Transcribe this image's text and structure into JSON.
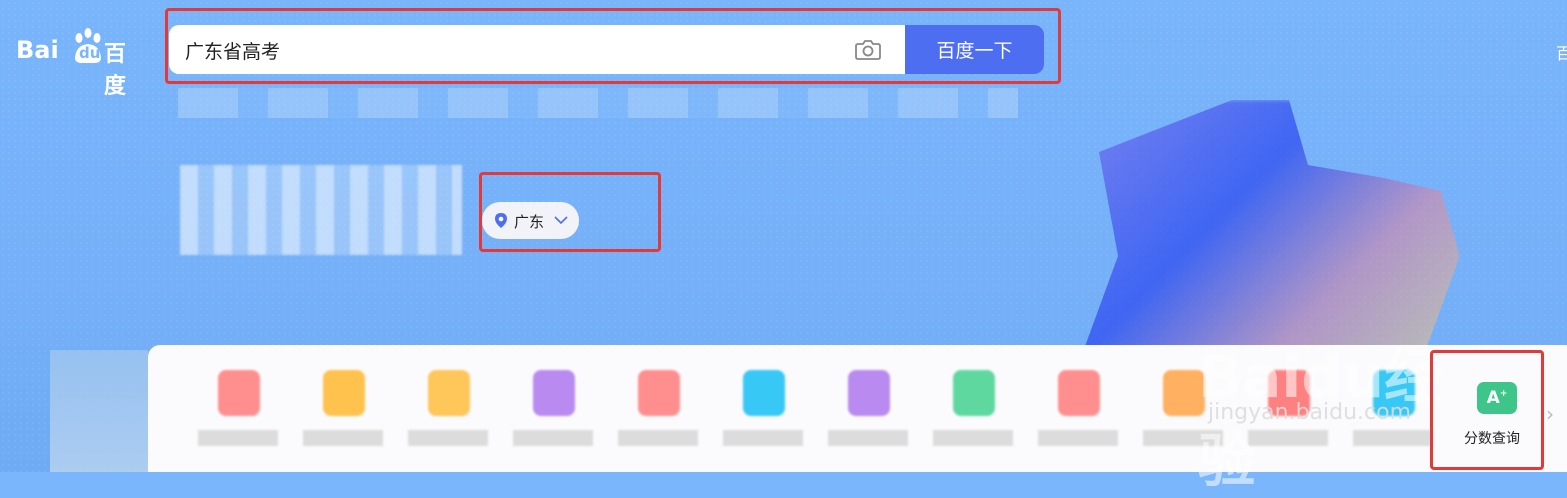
{
  "logo": {
    "bai": "Bai",
    "du": "du",
    "cn": "百度"
  },
  "search": {
    "query": "广东省高考",
    "button_label": "百度一下"
  },
  "header": {
    "corner_link": "百"
  },
  "location": {
    "label": "广东"
  },
  "score_tile": {
    "icon_text": "A",
    "icon_sup": "+",
    "label": "分数查询"
  },
  "watermark": {
    "main": "Baidu经验",
    "sub": "jingyan.baidu.com"
  },
  "colors": {
    "background": "#7ab6fb",
    "search_button": "#4e6ef2",
    "highlight_box": "#e23a3a",
    "score_icon": "#3ec58a"
  }
}
